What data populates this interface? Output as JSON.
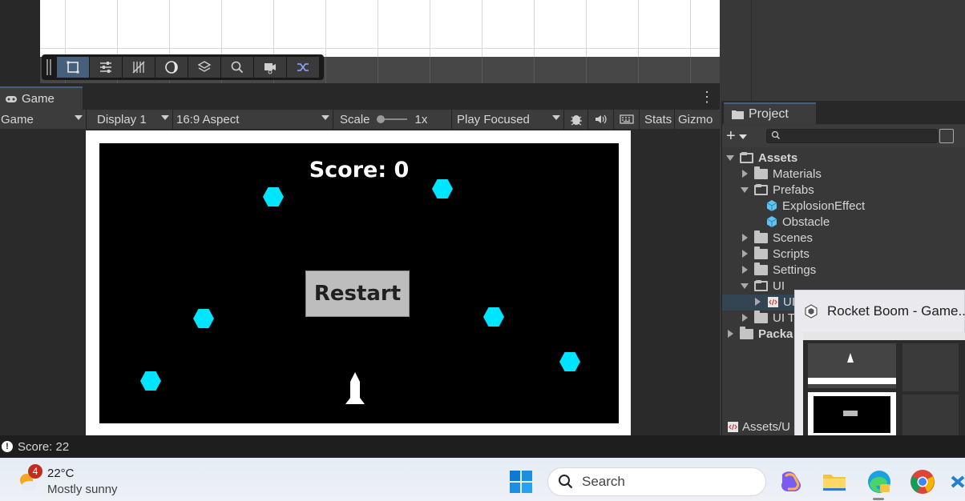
{
  "game_panel": {
    "tab_label": "Game",
    "controls": {
      "target": "Game",
      "display": "Display 1",
      "aspect": "16:9 Aspect",
      "scale_label": "Scale",
      "scale_value": "1x",
      "play_mode": "Play Focused",
      "stats": "Stats",
      "gizmos": "Gizmo"
    },
    "game": {
      "score_text": "Score: 0",
      "restart_label": "Restart",
      "obstacle_color": "#00e5ff"
    }
  },
  "project_panel": {
    "tab_label": "Project",
    "tree": {
      "assets": "Assets",
      "materials": "Materials",
      "prefabs": "Prefabs",
      "explosion_effect": "ExplosionEffect",
      "obstacle": "Obstacle",
      "scenes": "Scenes",
      "scripts": "Scripts",
      "settings": "Settings",
      "ui": "UI",
      "ui_child": "UI",
      "ui_toolkit": "UI To",
      "packages": "Packa"
    },
    "footer_path": "Assets/U"
  },
  "thumbnail_popup": {
    "title": "Rocket Boom - Game..."
  },
  "status_bar": {
    "message": "Score: 22"
  },
  "taskbar": {
    "weather_badge": "4",
    "weather_temp": "22°C",
    "weather_desc": "Mostly sunny",
    "search_label": "Search"
  },
  "theme": {
    "accent": "#46607c",
    "editor_bg": "#383838"
  }
}
